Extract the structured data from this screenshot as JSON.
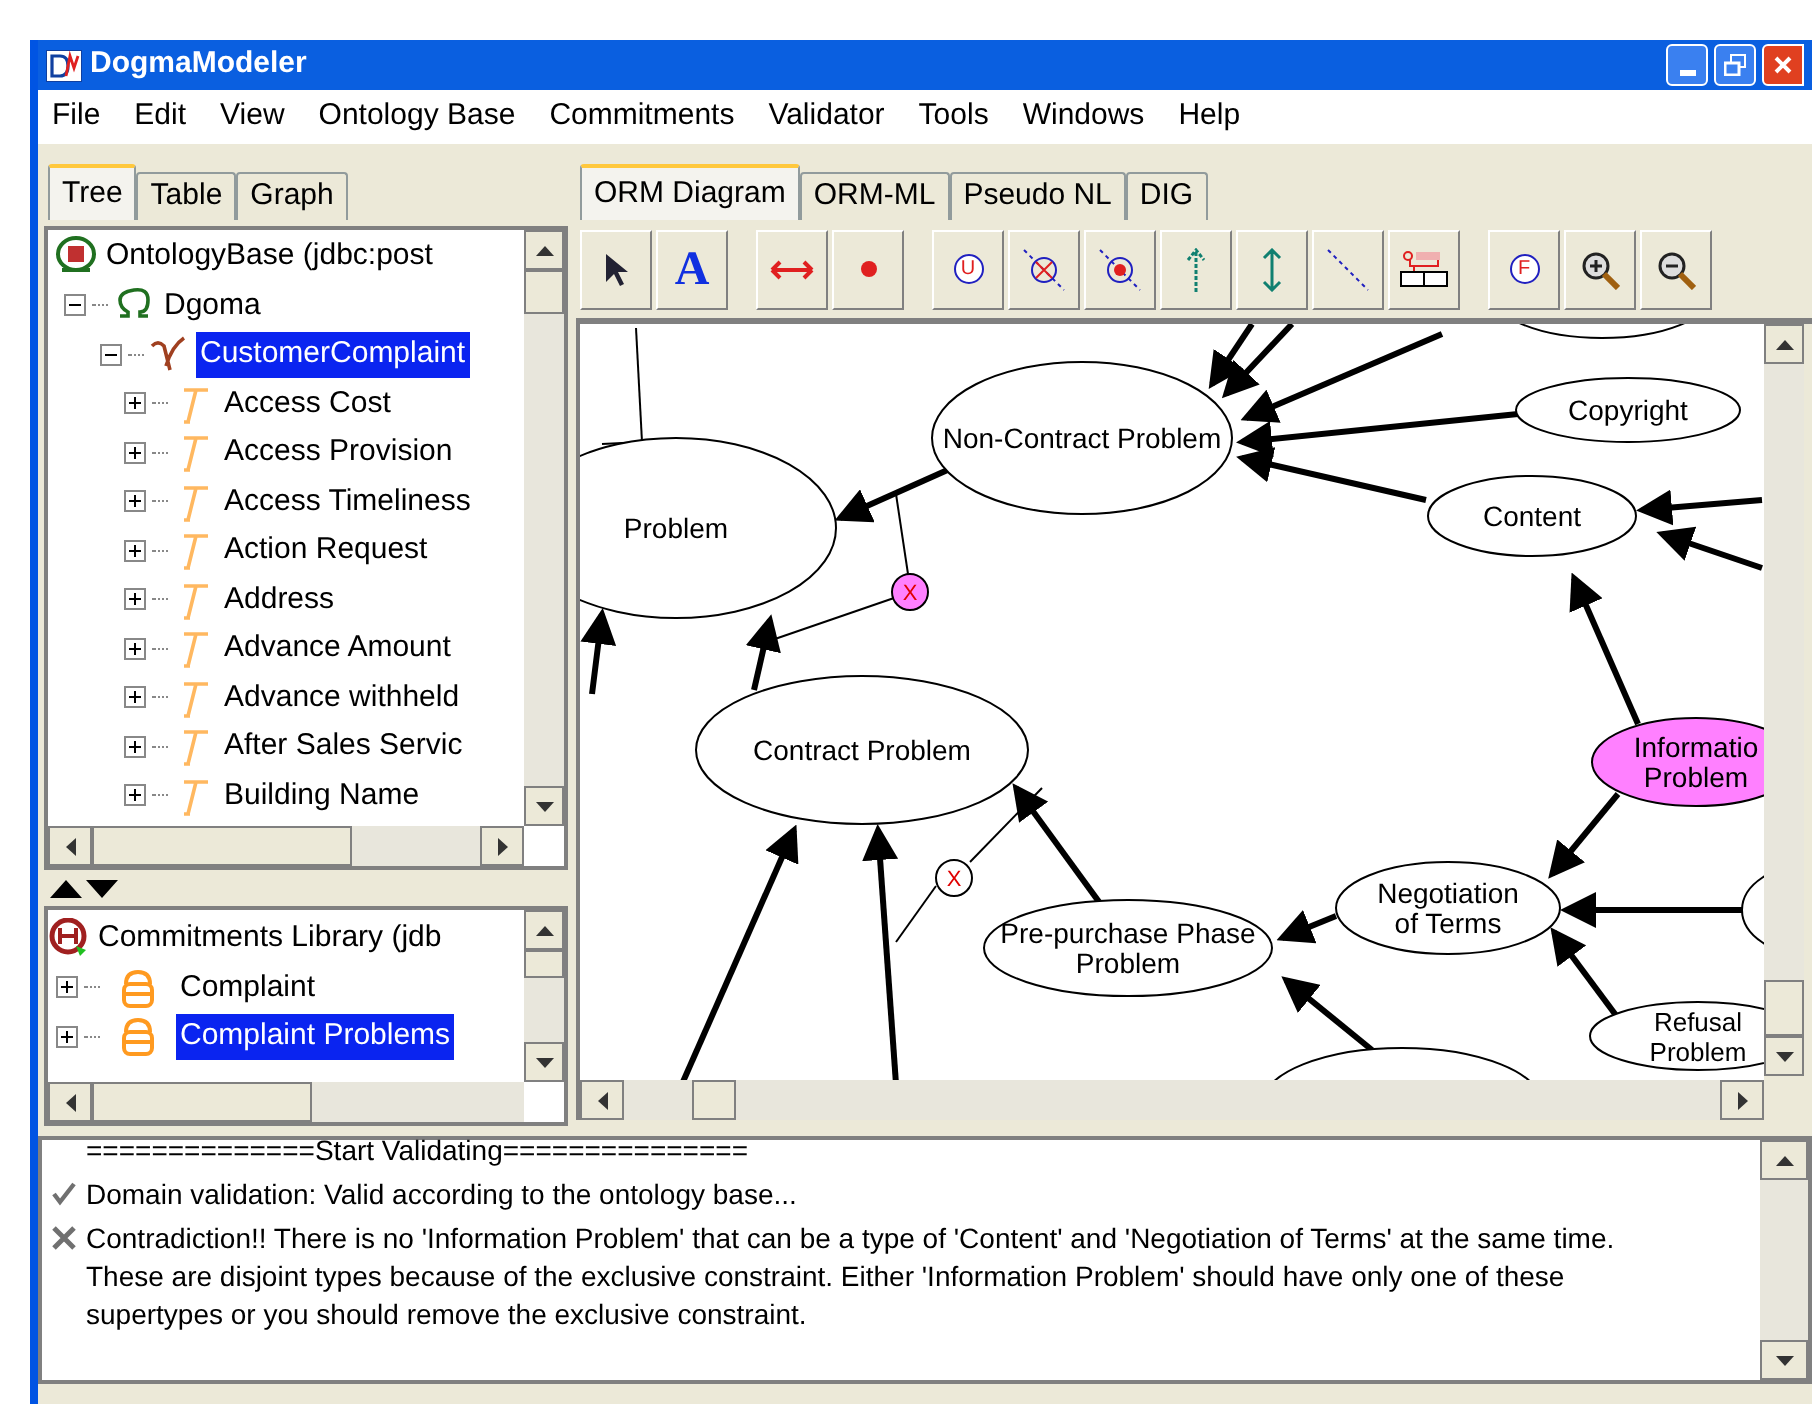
{
  "window": {
    "title": "DogmaModeler"
  },
  "menu": [
    "File",
    "Edit",
    "View",
    "Ontology Base",
    "Commitments",
    "Validator",
    "Tools",
    "Windows",
    "Help"
  ],
  "left_tabs": [
    {
      "label": "Tree",
      "selected": true
    },
    {
      "label": "Table",
      "selected": false
    },
    {
      "label": "Graph",
      "selected": false
    }
  ],
  "ontology_tree": {
    "label": "OntologyBase (jdbc:post",
    "children": [
      {
        "label": "Dgoma",
        "expanded": true,
        "children": [
          {
            "label": "CustomerComplaint",
            "expanded": true,
            "selected": true,
            "children": [
              {
                "label": "Access Cost",
                "selected": false
              },
              {
                "label": "Access Provision",
                "selected": false
              },
              {
                "label": "Access Timeliness",
                "selected": false
              },
              {
                "label": "Action Request",
                "selected": false
              },
              {
                "label": "Address",
                "selected": false
              },
              {
                "label": "Advance Amount",
                "selected": false
              },
              {
                "label": "Advance withheld",
                "selected": false
              },
              {
                "label": "After Sales Servic",
                "selected": false
              },
              {
                "label": "Building Name",
                "selected": false
              }
            ]
          }
        ]
      }
    ]
  },
  "commitments_tree": {
    "label": "Commitments Library (jdb",
    "children": [
      {
        "label": "Complaint",
        "selected": false
      },
      {
        "label": "Complaint Problems",
        "selected": true
      }
    ]
  },
  "editor_tabs": [
    {
      "label": "ORM Diagram",
      "selected": true
    },
    {
      "label": "ORM-ML",
      "selected": false
    },
    {
      "label": "Pseudo NL",
      "selected": false
    },
    {
      "label": "DIG",
      "selected": false
    }
  ],
  "toolbar": {
    "text_tool": "A",
    "uniqueness_tool": "U",
    "frequency_tool": "F"
  },
  "diagram": {
    "nodes": [
      {
        "lines": [
          "Non-Contract Problem"
        ],
        "highlighted": false
      },
      {
        "lines": [
          "Copyright"
        ],
        "highlighted": false
      },
      {
        "lines": [
          "Content"
        ],
        "highlighted": false
      },
      {
        "lines": [
          "Problem"
        ],
        "highlighted": false
      },
      {
        "lines": [
          "Contract Problem"
        ],
        "highlighted": false
      },
      {
        "lines": [
          "Informatio",
          "Problem"
        ],
        "highlighted": true
      },
      {
        "lines": [
          "Negotiation",
          "of Terms"
        ],
        "highlighted": false
      },
      {
        "lines": [
          "Pre-purchase Phase",
          "Problem"
        ],
        "highlighted": false
      },
      {
        "lines": [
          "Refusal",
          "Problem"
        ],
        "highlighted": false
      }
    ],
    "constraints": [
      {
        "label": "X",
        "highlighted": true
      },
      {
        "label": "X",
        "highlighted": false
      }
    ]
  },
  "log": [
    {
      "kind": "header",
      "text": "==============Start Validating==============="
    },
    {
      "kind": "ok",
      "text": "Domain validation: Valid according to the ontology base..."
    },
    {
      "kind": "error",
      "text": "Contradiction!! There is no 'Information Problem' that can be a type of 'Content' and 'Negotiation of Terms' at the same time. These are disjoint types because of the exclusive constraint. Either  'Information Problem' should have only one of these supertypes or you should remove the exclusive constraint."
    }
  ]
}
